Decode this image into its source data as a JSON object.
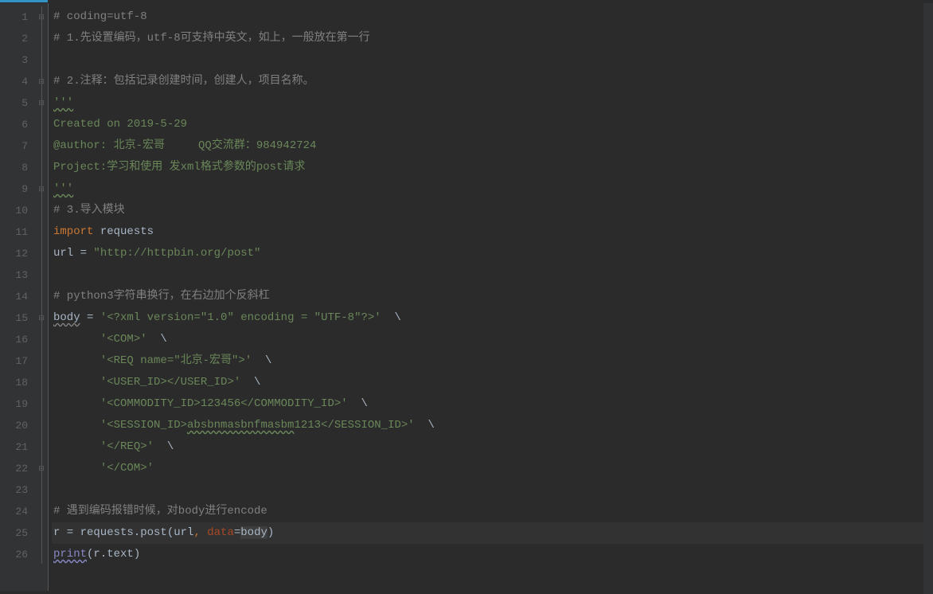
{
  "lineNumbers": [
    "1",
    "2",
    "3",
    "4",
    "5",
    "6",
    "7",
    "8",
    "9",
    "10",
    "11",
    "12",
    "13",
    "14",
    "15",
    "16",
    "17",
    "18",
    "19",
    "20",
    "21",
    "22",
    "23",
    "24",
    "25",
    "26"
  ],
  "fold": {
    "l1": "⊟",
    "l4": "⊟",
    "l5": "⊟",
    "l9": "⊟",
    "l15": "⊟",
    "l22": "⊟"
  },
  "code": {
    "l1": "# coding=utf-8",
    "l2": "# 1.先设置编码，utf-8可支持中英文，如上，一般放在第一行",
    "l3": "",
    "l4": "# 2.注释：包括记录创建时间，创建人，项目名称。",
    "l5": "'''",
    "l6": "Created on 2019-5-29",
    "l7": "@author: 北京-宏哥     QQ交流群：984942724",
    "l8": "Project:学习和使用 发xml格式参数的post请求",
    "l9": "'''",
    "l10": "# 3.导入模块",
    "l11_import": "import",
    "l11_rest": " requests",
    "l12_a": "url ",
    "l12_b": "= ",
    "l12_c": "\"http://httpbin.org/post\"",
    "l13": "",
    "l14": "# python3字符串换行，在右边加个反斜杠",
    "l15_a": "body",
    "l15_b": " = ",
    "l15_c": "'<?xml version=\"1.0\" encoding = \"UTF-8\"?>'",
    "l15_d": "  \\",
    "l16_a": "       ",
    "l16_b": "'<COM>'",
    "l16_c": "  \\",
    "l17_a": "       ",
    "l17_b": "'<REQ name=\"北京-宏哥\">'",
    "l17_c": "  \\",
    "l18_a": "       ",
    "l18_b": "'<USER_ID></USER_ID>'",
    "l18_c": "  \\",
    "l19_a": "       ",
    "l19_b": "'<COMMODITY_ID>123456</COMMODITY_ID>'",
    "l19_c": "  \\",
    "l20_a": "       ",
    "l20_b": "'<SESSION_ID>",
    "l20_c": "absbnmasbnfmasbm",
    "l20_d": "1213</SESSION_ID>'",
    "l20_e": "  \\",
    "l21_a": "       ",
    "l21_b": "'</REQ>'",
    "l21_c": "  \\",
    "l22_a": "       ",
    "l22_b": "'</COM>'",
    "l23": "",
    "l24": "# 遇到编码报错时候，对body进行encode",
    "l25_a": "r = requests.post(url",
    "l25_b": ", ",
    "l25_c": "data",
    "l25_d": "=",
    "l25_e": "body",
    "l25_f": ")",
    "l26_a": "print",
    "l26_b": "(r.text)"
  }
}
